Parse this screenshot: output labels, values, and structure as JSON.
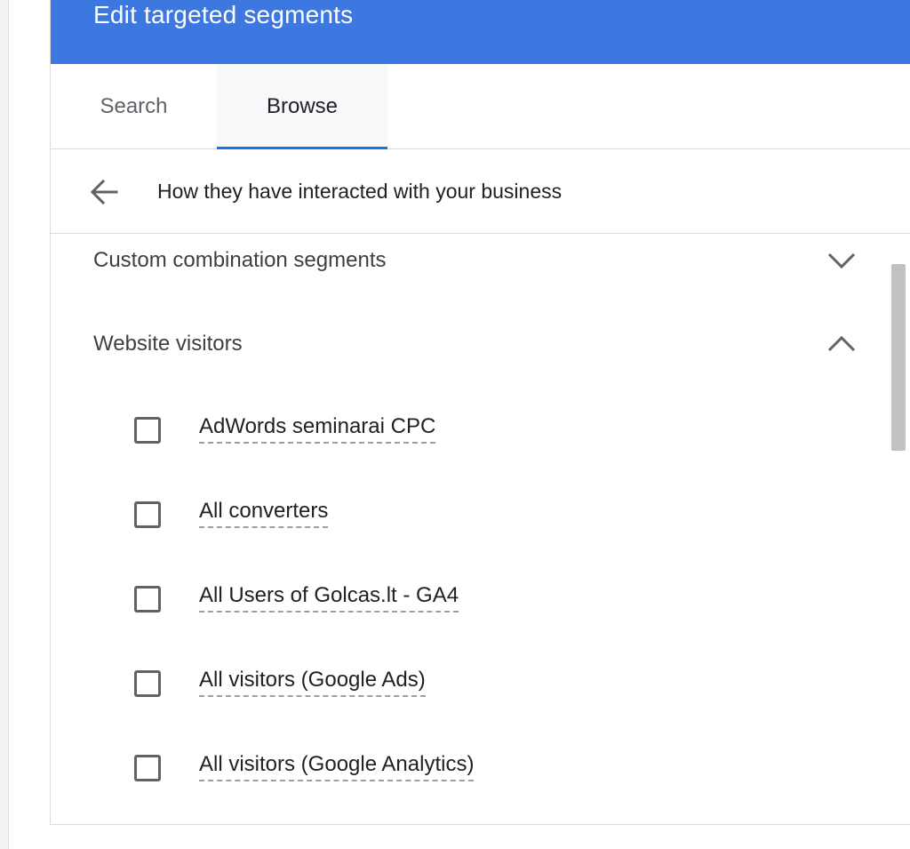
{
  "dialog": {
    "title": "Edit targeted segments"
  },
  "tabs": [
    {
      "label": "Search",
      "active": false
    },
    {
      "label": "Browse",
      "active": true
    }
  ],
  "breadcrumb": {
    "back_icon": "arrow-left-icon",
    "label": "How they have interacted with your business"
  },
  "sections": [
    {
      "label": "Custom combination segments",
      "expanded": false,
      "icon": "chevron-down-icon"
    },
    {
      "label": "Website visitors",
      "expanded": true,
      "icon": "chevron-up-icon"
    }
  ],
  "website_visitors": {
    "items": [
      {
        "label": "AdWords seminarai CPC",
        "checked": false
      },
      {
        "label": "All converters",
        "checked": false
      },
      {
        "label": "All Users of Golcas.lt - GA4",
        "checked": false
      },
      {
        "label": "All visitors (Google Ads)",
        "checked": false
      },
      {
        "label": "All visitors (Google Analytics)",
        "checked": false
      }
    ]
  },
  "colors": {
    "header_bg": "#3c78e0",
    "tab_active_indicator": "#1a73e8",
    "text_primary": "#202124",
    "text_secondary": "#5f6368"
  }
}
